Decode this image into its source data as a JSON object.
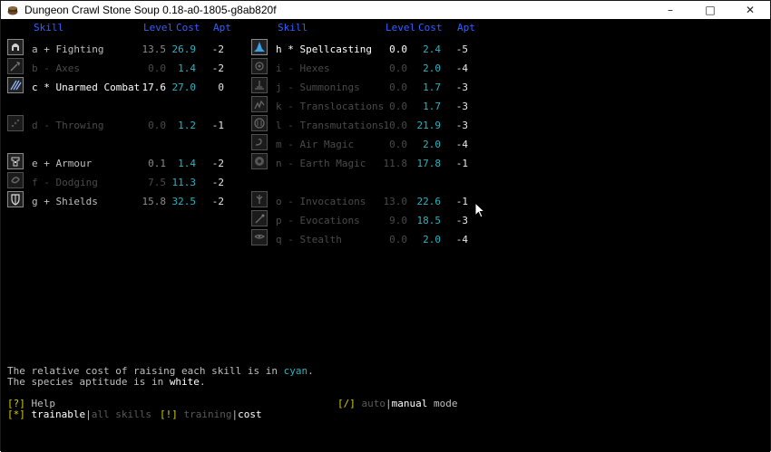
{
  "window": {
    "title": "Dungeon Crawl Stone Soup 0.18-a0-1805-g8ab820f",
    "minimize": "–",
    "maximize": "□",
    "close": "✕"
  },
  "headers": {
    "skill": "Skill",
    "level": "Level",
    "cost": "Cost",
    "apt": "Apt"
  },
  "left_skills": [
    {
      "hotkey": "a",
      "mark": "+",
      "name": "Fighting",
      "level": "13.5",
      "cost": "26.9",
      "apt": "-2",
      "style": "normal",
      "icon": "helmet-icon"
    },
    {
      "hotkey": "b",
      "mark": "-",
      "name": "Axes",
      "level": "0.0",
      "cost": "1.4",
      "apt": "-2",
      "style": "dim",
      "icon": "axe-icon"
    },
    {
      "hotkey": "c",
      "mark": "*",
      "name": "Unarmed Combat",
      "level": "17.6",
      "cost": "27.0",
      "apt": "0",
      "style": "bright",
      "icon": "claw-icon"
    },
    {
      "hotkey": "d",
      "mark": "-",
      "name": "Throwing",
      "level": "0.0",
      "cost": "1.2",
      "apt": "-1",
      "style": "dim",
      "icon": "throwing-icon"
    },
    {
      "hotkey": "e",
      "mark": "+",
      "name": "Armour",
      "level": "0.1",
      "cost": "1.4",
      "apt": "-2",
      "style": "normal",
      "icon": "armour-icon"
    },
    {
      "hotkey": "f",
      "mark": "-",
      "name": "Dodging",
      "level": "7.5",
      "cost": "11.3",
      "apt": "-2",
      "style": "dim",
      "icon": "dodging-icon"
    },
    {
      "hotkey": "g",
      "mark": "+",
      "name": "Shields",
      "level": "15.8",
      "cost": "32.5",
      "apt": "-2",
      "style": "normal",
      "icon": "shield-icon"
    }
  ],
  "right_skills": [
    {
      "hotkey": "h",
      "mark": "*",
      "name": "Spellcasting",
      "level": "0.0",
      "cost": "2.4",
      "apt": "-5",
      "style": "bright",
      "icon": "wizard-hat-icon"
    },
    {
      "hotkey": "i",
      "mark": "-",
      "name": "Hexes",
      "level": "0.0",
      "cost": "2.0",
      "apt": "-4",
      "style": "dim",
      "icon": "hexes-icon"
    },
    {
      "hotkey": "j",
      "mark": "-",
      "name": "Summonings",
      "level": "0.0",
      "cost": "1.7",
      "apt": "-3",
      "style": "dim",
      "icon": "summonings-icon"
    },
    {
      "hotkey": "k",
      "mark": "-",
      "name": "Translocations",
      "level": "0.0",
      "cost": "1.7",
      "apt": "-3",
      "style": "dim",
      "icon": "translocations-icon"
    },
    {
      "hotkey": "l",
      "mark": "-",
      "name": "Transmutations",
      "level": "10.0",
      "cost": "21.9",
      "apt": "-3",
      "style": "dim",
      "icon": "transmutations-icon"
    },
    {
      "hotkey": "m",
      "mark": "-",
      "name": "Air Magic",
      "level": "0.0",
      "cost": "2.0",
      "apt": "-4",
      "style": "dim",
      "icon": "air-magic-icon"
    },
    {
      "hotkey": "n",
      "mark": "-",
      "name": "Earth Magic",
      "level": "11.8",
      "cost": "17.8",
      "apt": "-1",
      "style": "dim",
      "icon": "earth-magic-icon"
    },
    {
      "hotkey": "o",
      "mark": "-",
      "name": "Invocations",
      "level": "13.0",
      "cost": "22.6",
      "apt": "-1",
      "style": "dim",
      "icon": "invocations-icon"
    },
    {
      "hotkey": "p",
      "mark": "-",
      "name": "Evocations",
      "level": "9.0",
      "cost": "18.5",
      "apt": "-3",
      "style": "dim",
      "icon": "evocations-icon"
    },
    {
      "hotkey": "q",
      "mark": "-",
      "name": "Stealth",
      "level": "0.0",
      "cost": "2.0",
      "apt": "-4",
      "style": "dim",
      "icon": "stealth-icon"
    }
  ],
  "footer": {
    "line1_prefix": "The relative cost of raising each skill is in ",
    "line1_word": "cyan",
    "line1_suffix": ".",
    "line2_prefix": "The species aptitude is in ",
    "line2_word": "white",
    "line2_suffix": ".",
    "help_key": "[?]",
    "help_label": " Help",
    "mode_key": "[/]",
    "mode_auto": " auto",
    "mode_sep": "|",
    "mode_manual": "manual",
    "mode_suffix": " mode",
    "filter_key": "[*]",
    "filter_trainable": " trainable",
    "filter_sep": "|",
    "filter_all": "all skills",
    "view_key": "[!]",
    "view_training": " training",
    "view_sep": "|",
    "view_cost": "cost"
  },
  "colors": {
    "heading": "#3060ff",
    "cost": "#2ab3c0",
    "key": "#d6d000",
    "background": "#000000"
  }
}
